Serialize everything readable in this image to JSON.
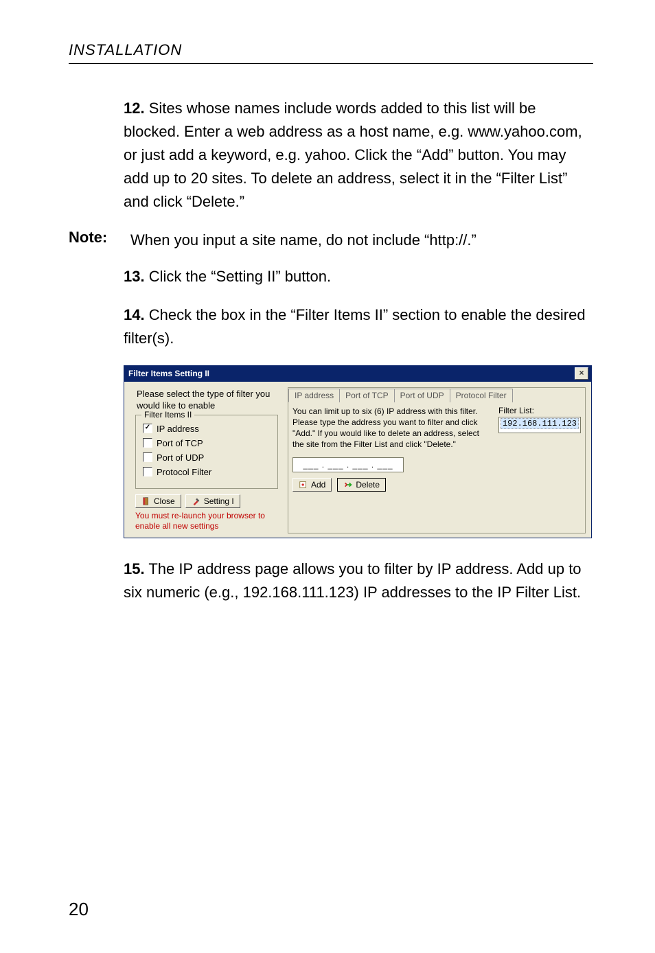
{
  "header": "INSTALLATION",
  "steps": {
    "s12": {
      "num": "12.",
      "text": "Sites whose names include words added to this list will be blocked. Enter a web address as a host name, e.g. www.yahoo.com, or just add a keyword, e.g. yahoo. Click the “Add” button. You may add up to 20 sites. To delete an address, select it in the “Filter List” and click “Delete.”"
    },
    "s13": {
      "num": "13.",
      "text": "Click the “Setting II” button."
    },
    "s14": {
      "num": "14.",
      "text": "Check the box in the “Filter Items II” section to enable the desired filter(s)."
    },
    "s15": {
      "num": "15.",
      "text": "The IP address page allows you to filter by IP address. Add up to six numeric (e.g., 192.168.111.123) IP addresses to the IP Filter List."
    }
  },
  "note": {
    "label": "Note:",
    "text": "When you input a site name, do not include “http://.”"
  },
  "dialog": {
    "title": "Filter Items Setting II",
    "close_glyph": "×",
    "intro": "Please select the type of filter you would like to enable",
    "group_title": "Filter Items II",
    "checks": {
      "ip": {
        "label": "IP address",
        "checked": true
      },
      "tcp": {
        "label": "Port of TCP",
        "checked": false
      },
      "udp": {
        "label": "Port of UDP",
        "checked": false
      },
      "prot": {
        "label": "Protocol Filter",
        "checked": false
      }
    },
    "buttons": {
      "close": "Close",
      "setting1": "Setting I"
    },
    "warning": "You must re-launch your browser to enable all new settings",
    "tabs": {
      "ip": "IP address",
      "tcp": "Port of TCP",
      "udp": "Port of UDP",
      "prot": "Protocol Filter"
    },
    "tab_instruction": "You can limit up to six (6) IP address with this filter. Please type the address you want to filter and click \"Add.\"  If you would like to delete an address, select the site from the Filter List and click \"Delete.\"",
    "filter_list_label": "Filter List:",
    "filter_list_item": "192.168.111.123",
    "ip_entry_placeholder": "___ . ___ . ___ . ___",
    "add_btn": "Add",
    "delete_btn": "Delete"
  },
  "page_number": "20"
}
